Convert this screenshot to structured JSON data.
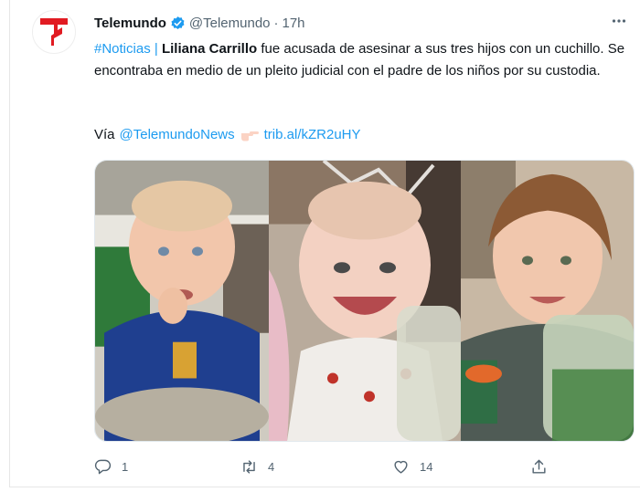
{
  "account": {
    "name": "Telemundo",
    "handle": "@Telemundo",
    "separator": "·",
    "time": "17h"
  },
  "tweet": {
    "hashtag": "#Noticias",
    "pipe": "|",
    "bold_name": "Liliana Carrillo",
    "body": "fue acusada de asesinar a sus tres hijos con un cuchillo. Se encontraba en medio de un pleito judicial con el padre de los niños por su custodia.",
    "via_label": "Vía",
    "via_mention": "@TelemundoNews",
    "via_link": "trib.al/kZR2uHY"
  },
  "actions": {
    "replies": "1",
    "retweets": "4",
    "likes": "14"
  },
  "colors": {
    "brand_red": "#e11b22",
    "link_blue": "#1d9bf0",
    "muted_gray": "#536471"
  },
  "icons": [
    "telemundo-logo",
    "verified-badge-icon",
    "more-options-icon",
    "pointing-hand-icon",
    "reply-icon",
    "retweet-icon",
    "like-icon",
    "share-icon"
  ]
}
